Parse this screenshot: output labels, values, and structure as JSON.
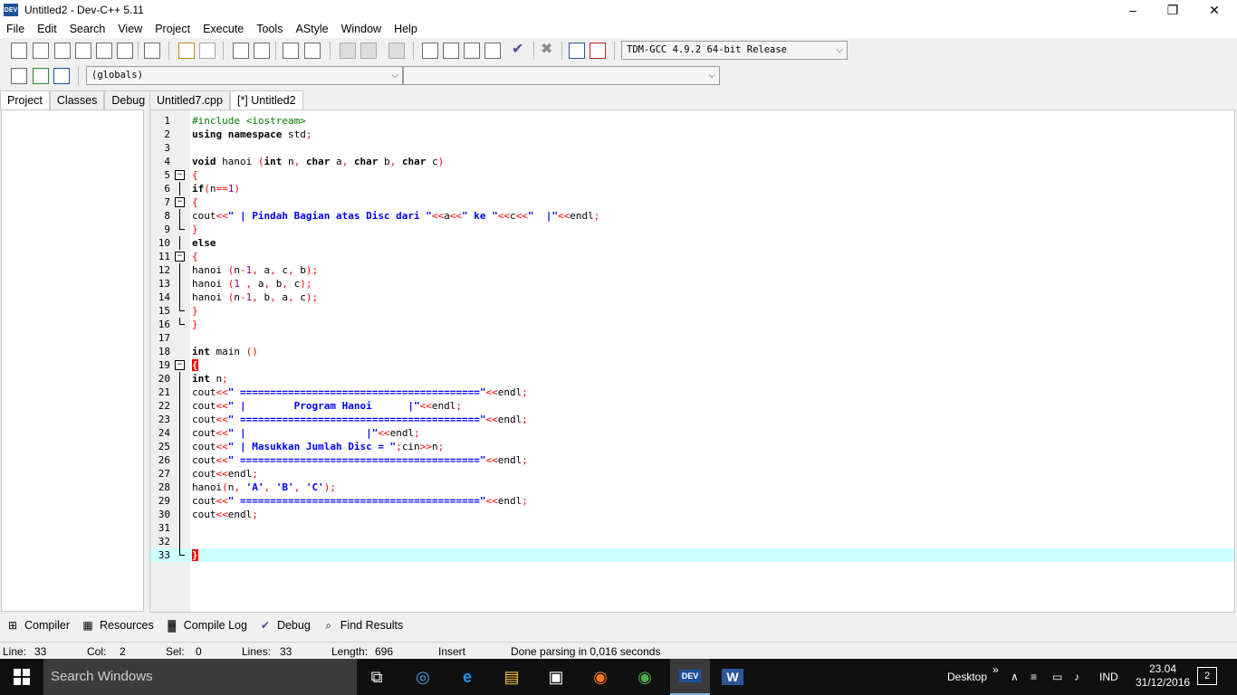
{
  "window": {
    "title": "Untitled2 - Dev-C++ 5.11",
    "app_icon_text": "DEV"
  },
  "menu": [
    "File",
    "Edit",
    "Search",
    "View",
    "Project",
    "Execute",
    "Tools",
    "AStyle",
    "Window",
    "Help"
  ],
  "toolbar": {
    "compiler_select": "TDM-GCC 4.9.2 64-bit Release",
    "scope_select": "(globals)",
    "member_select": ""
  },
  "left_tabs": [
    "Project",
    "Classes",
    "Debug"
  ],
  "editor_tabs": [
    "Untitled7.cpp",
    "[*] Untitled2"
  ],
  "code_lines": [
    {
      "n": "1",
      "html": "<span class=\"pp\">#include &lt;iostream&gt;</span>"
    },
    {
      "n": "2",
      "html": "using namespace <span style=\"font-weight:normal\">std</span><span class=\"sy\">;</span>"
    },
    {
      "n": "3",
      "html": ""
    },
    {
      "n": "4",
      "html": "void <span style=\"font-weight:normal\">hanoi </span><span class=\"sy\">(</span>int <span style=\"font-weight:normal\">n</span><span class=\"sy\">,</span> char <span style=\"font-weight:normal\">a</span><span class=\"sy\">,</span> char <span style=\"font-weight:normal\">b</span><span class=\"sy\">,</span> char <span style=\"font-weight:normal\">c</span><span class=\"sy\">)</span>"
    },
    {
      "n": "5",
      "html": "<span class=\"sy\">{</span>"
    },
    {
      "n": "6",
      "html": "if<span class=\"sy\">(</span><span style=\"font-weight:normal\">n</span><span class=\"sy\">==</span><span class=\"nm\">1</span><span class=\"sy\">)</span>"
    },
    {
      "n": "7",
      "html": "<span class=\"sy\">{</span>"
    },
    {
      "n": "8",
      "html": "<span style=\"font-weight:normal\">cout</span><span class=\"sy\">&lt;&lt;</span><span class=\"st\">\" | Pindah Bagian atas Disc dari \"</span><span class=\"sy\">&lt;&lt;</span><span style=\"font-weight:normal\">a</span><span class=\"sy\">&lt;&lt;</span><span class=\"st\">\" ke \"</span><span class=\"sy\">&lt;&lt;</span><span style=\"font-weight:normal\">c</span><span class=\"sy\">&lt;&lt;</span><span class=\"st\">\"  |\"</span><span class=\"sy\">&lt;&lt;</span><span style=\"font-weight:normal\">endl</span><span class=\"sy\">;</span>"
    },
    {
      "n": "9",
      "html": "<span class=\"sy\">}</span>"
    },
    {
      "n": "10",
      "html": "else"
    },
    {
      "n": "11",
      "html": "<span class=\"sy\">{</span>"
    },
    {
      "n": "12",
      "html": "<span style=\"font-weight:normal\">hanoi </span><span class=\"sy\">(</span><span style=\"font-weight:normal\">n</span><span class=\"sy\">-</span><span class=\"nm\">1</span><span class=\"sy\">,</span><span style=\"font-weight:normal\"> a</span><span class=\"sy\">,</span><span style=\"font-weight:normal\"> c</span><span class=\"sy\">,</span><span style=\"font-weight:normal\"> b</span><span class=\"sy\">);</span>"
    },
    {
      "n": "13",
      "html": "<span style=\"font-weight:normal\">hanoi </span><span class=\"sy\">(</span><span class=\"nm\">1</span><span style=\"font-weight:normal\"> </span><span class=\"sy\">,</span><span style=\"font-weight:normal\"> a</span><span class=\"sy\">,</span><span style=\"font-weight:normal\"> b</span><span class=\"sy\">,</span><span style=\"font-weight:normal\"> c</span><span class=\"sy\">);</span>"
    },
    {
      "n": "14",
      "html": "<span style=\"font-weight:normal\">hanoi </span><span class=\"sy\">(</span><span style=\"font-weight:normal\">n</span><span class=\"sy\">-</span><span class=\"nm\">1</span><span class=\"sy\">,</span><span style=\"font-weight:normal\"> b</span><span class=\"sy\">,</span><span style=\"font-weight:normal\"> a</span><span class=\"sy\">,</span><span style=\"font-weight:normal\"> c</span><span class=\"sy\">);</span>"
    },
    {
      "n": "15",
      "html": "<span class=\"sy\">}</span>"
    },
    {
      "n": "16",
      "html": "<span class=\"sy\">}</span>"
    },
    {
      "n": "17",
      "html": ""
    },
    {
      "n": "18",
      "html": "int <span style=\"font-weight:normal\">main </span><span class=\"sy\">()</span>"
    },
    {
      "n": "19",
      "html": "<span class=\"caretbox\">{</span>"
    },
    {
      "n": "20",
      "html": "int <span style=\"font-weight:normal\">n</span><span class=\"sy\">;</span>"
    },
    {
      "n": "21",
      "html": "<span style=\"font-weight:normal\">cout</span><span class=\"sy\">&lt;&lt;</span><span class=\"st\">\" ========================================\"</span><span class=\"sy\">&lt;&lt;</span><span style=\"font-weight:normal\">endl</span><span class=\"sy\">;</span>"
    },
    {
      "n": "22",
      "html": "<span style=\"font-weight:normal\">cout</span><span class=\"sy\">&lt;&lt;</span><span class=\"st\">\" |        Program Hanoi      |\"</span><span class=\"sy\">&lt;&lt;</span><span style=\"font-weight:normal\">endl</span><span class=\"sy\">;</span>"
    },
    {
      "n": "23",
      "html": "<span style=\"font-weight:normal\">cout</span><span class=\"sy\">&lt;&lt;</span><span class=\"st\">\" ========================================\"</span><span class=\"sy\">&lt;&lt;</span><span style=\"font-weight:normal\">endl</span><span class=\"sy\">;</span>"
    },
    {
      "n": "24",
      "html": "<span style=\"font-weight:normal\">cout</span><span class=\"sy\">&lt;&lt;</span><span class=\"st\">\" |                    |\"</span><span class=\"sy\">&lt;&lt;</span><span style=\"font-weight:normal\">endl</span><span class=\"sy\">;</span>"
    },
    {
      "n": "25",
      "html": "<span style=\"font-weight:normal\">cout</span><span class=\"sy\">&lt;&lt;</span><span class=\"st\">\" | Masukkan Jumlah Disc = \"</span><span class=\"sy\">;</span><span style=\"font-weight:normal\">cin</span><span class=\"sy\">&gt;&gt;</span><span style=\"font-weight:normal\">n</span><span class=\"sy\">;</span>"
    },
    {
      "n": "26",
      "html": "<span style=\"font-weight:normal\">cout</span><span class=\"sy\">&lt;&lt;</span><span class=\"st\">\" ========================================\"</span><span class=\"sy\">&lt;&lt;</span><span style=\"font-weight:normal\">endl</span><span class=\"sy\">;</span>"
    },
    {
      "n": "27",
      "html": "<span style=\"font-weight:normal\">cout</span><span class=\"sy\">&lt;&lt;</span><span style=\"font-weight:normal\">endl</span><span class=\"sy\">;</span>"
    },
    {
      "n": "28",
      "html": "<span style=\"font-weight:normal\">hanoi</span><span class=\"sy\">(</span><span style=\"font-weight:normal\">n</span><span class=\"sy\">,</span><span style=\"font-weight:normal\"> </span><span class=\"st\">'A'</span><span class=\"sy\">,</span><span style=\"font-weight:normal\"> </span><span class=\"st\">'B'</span><span class=\"sy\">,</span><span style=\"font-weight:normal\"> </span><span class=\"st\">'C'</span><span class=\"sy\">);</span>"
    },
    {
      "n": "29",
      "html": "<span style=\"font-weight:normal\">cout</span><span class=\"sy\">&lt;&lt;</span><span class=\"st\">\" ========================================\"</span><span class=\"sy\">&lt;&lt;</span><span style=\"font-weight:normal\">endl</span><span class=\"sy\">;</span>"
    },
    {
      "n": "30",
      "html": "<span style=\"font-weight:normal\">cout</span><span class=\"sy\">&lt;&lt;</span><span style=\"font-weight:normal\">endl</span><span class=\"sy\">;</span>"
    },
    {
      "n": "31",
      "html": ""
    },
    {
      "n": "32",
      "html": ""
    },
    {
      "n": "33",
      "html": "<span class=\"caretbox\">}</span>"
    }
  ],
  "bottom_tabs": [
    {
      "label": "Compiler",
      "icon": "grid-icon"
    },
    {
      "label": "Resources",
      "icon": "resources-icon"
    },
    {
      "label": "Compile Log",
      "icon": "bar-chart-icon"
    },
    {
      "label": "Debug",
      "icon": "check-icon"
    },
    {
      "label": "Find Results",
      "icon": "find-icon"
    }
  ],
  "status": {
    "line_label": "Line:",
    "line": "33",
    "col_label": "Col:",
    "col": "2",
    "sel_label": "Sel:",
    "sel": "0",
    "lines_label": "Lines:",
    "lines": "33",
    "length_label": "Length:",
    "length": "696",
    "mode": "Insert",
    "message": "Done parsing in 0,016 seconds"
  },
  "taskbar": {
    "search_placeholder": "Search Windows",
    "desktop_label": "Desktop",
    "language": "IND",
    "time": "23.04",
    "date": "31/12/2016",
    "notifications": "2",
    "devcpp_icon_text": "DEV",
    "word_icon_text": "W"
  },
  "colors": {
    "current_line": "#ccffff",
    "string": "#0000ff",
    "symbol": "#ff0000",
    "preprocessor": "#008000",
    "number": "#800080"
  }
}
